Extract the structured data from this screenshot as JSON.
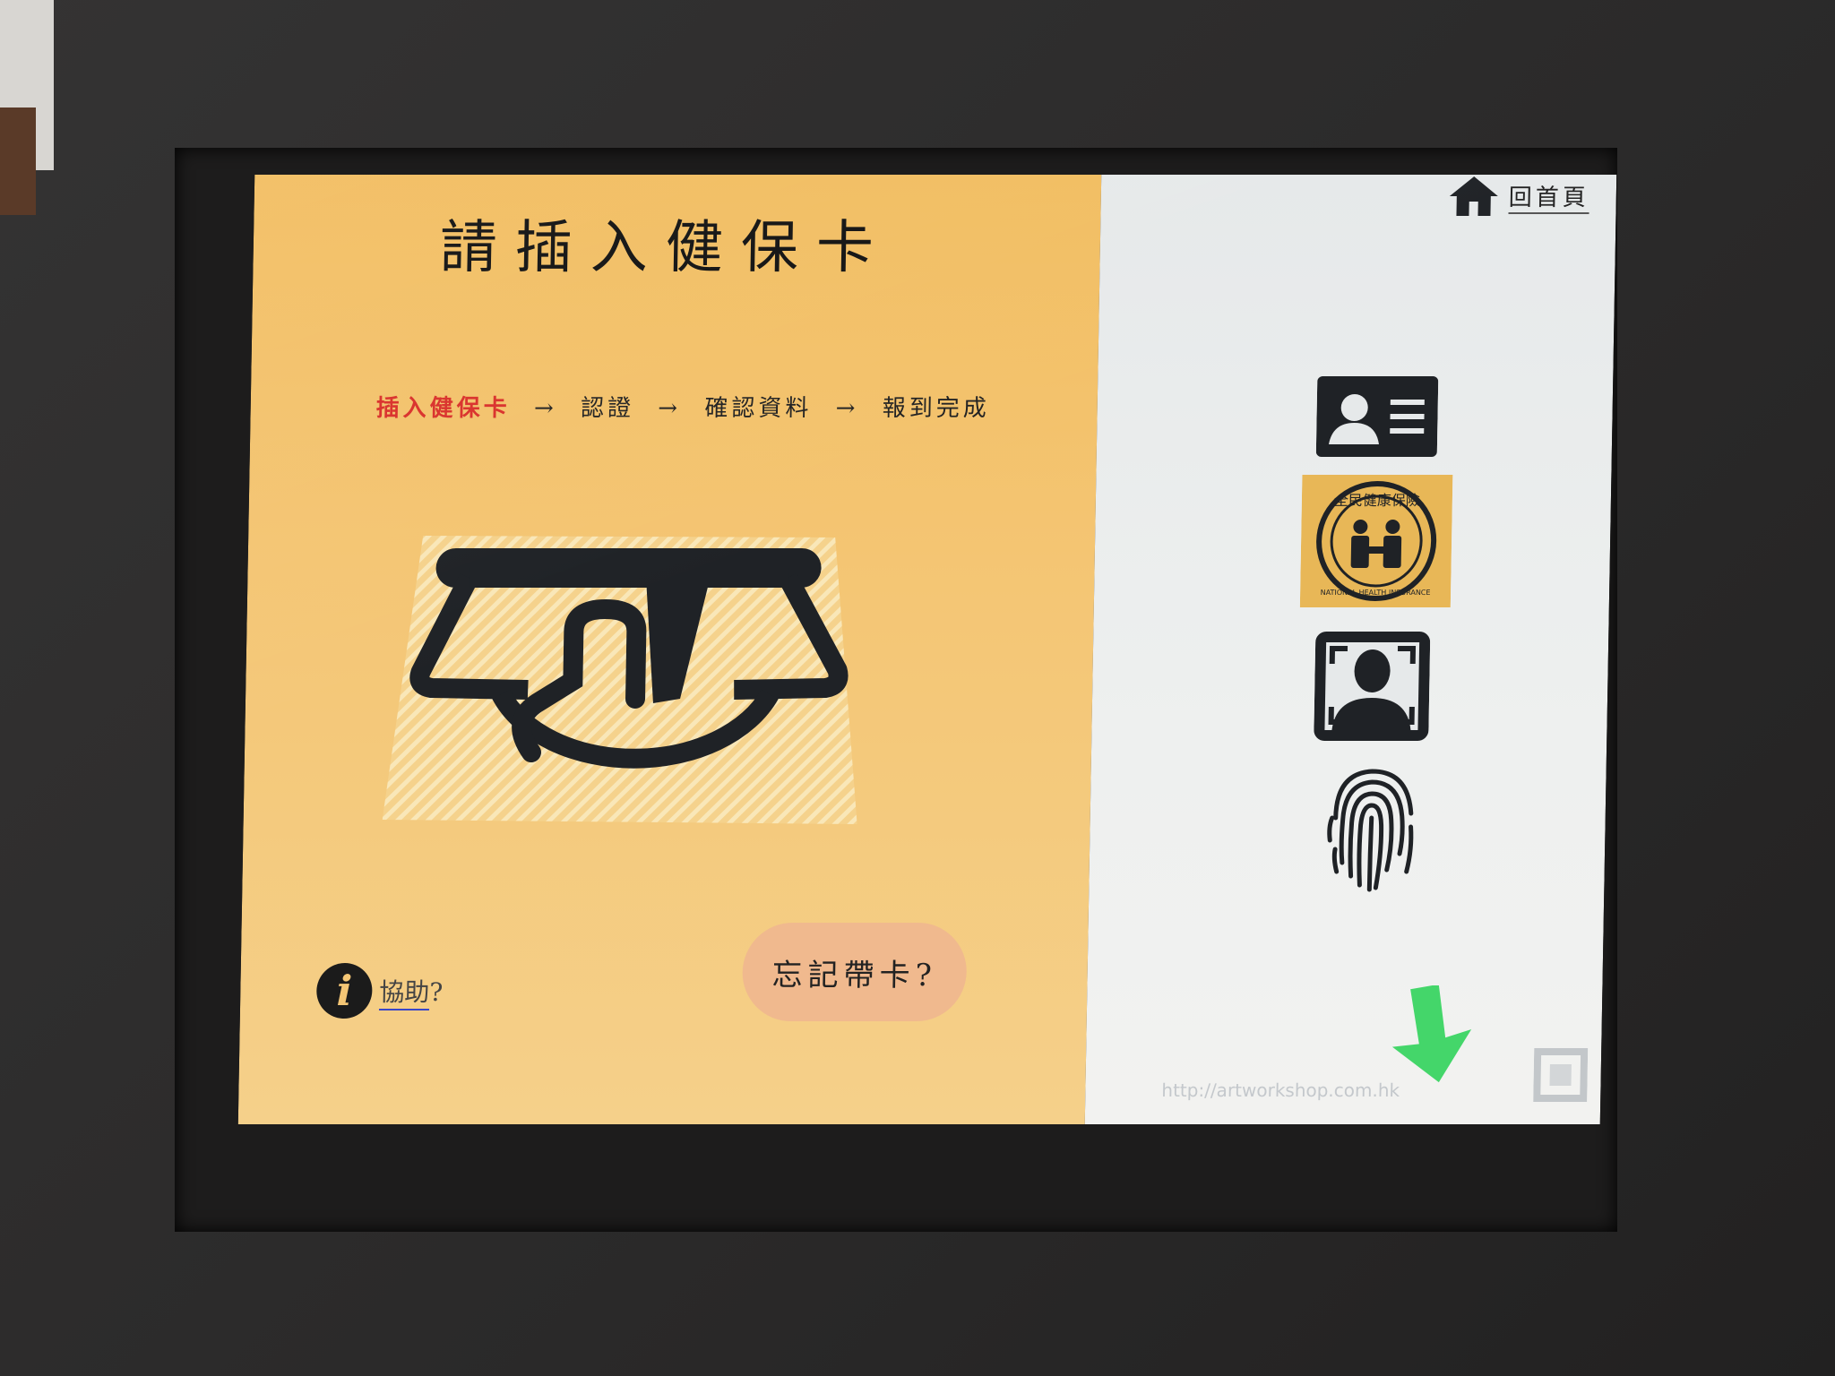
{
  "kiosk": {
    "title": "請插入健保卡",
    "steps": [
      {
        "label": "插入健保卡",
        "active": true
      },
      {
        "label": "認證",
        "active": false
      },
      {
        "label": "確認資料",
        "active": false
      },
      {
        "label": "報到完成",
        "active": false
      }
    ],
    "step_arrow": "→",
    "help_label": "協助",
    "help_suffix": "?",
    "forgot_card_label": "忘記帶卡?",
    "home_label": "回首頁",
    "nhi_badge_text": "全民健康保險",
    "nhi_badge_english": "NATIONAL HEALTH INSURANCE",
    "footer_url": "http://artworkshop.com.hk",
    "help_icon_glyph": "i"
  },
  "icons": {
    "home": "house-icon",
    "id_card": "id-card-icon",
    "nhi": "national-health-insurance-logo",
    "face_scan": "face-scan-icon",
    "fingerprint": "fingerprint-icon",
    "download_arrow": "download-arrow-icon"
  },
  "colors": {
    "left_panel": "#f4c675",
    "active_step": "#d9302a",
    "forgot_button": "#f0b98e",
    "arrow_green": "#44d66a",
    "icon_dark": "#1f2226"
  }
}
